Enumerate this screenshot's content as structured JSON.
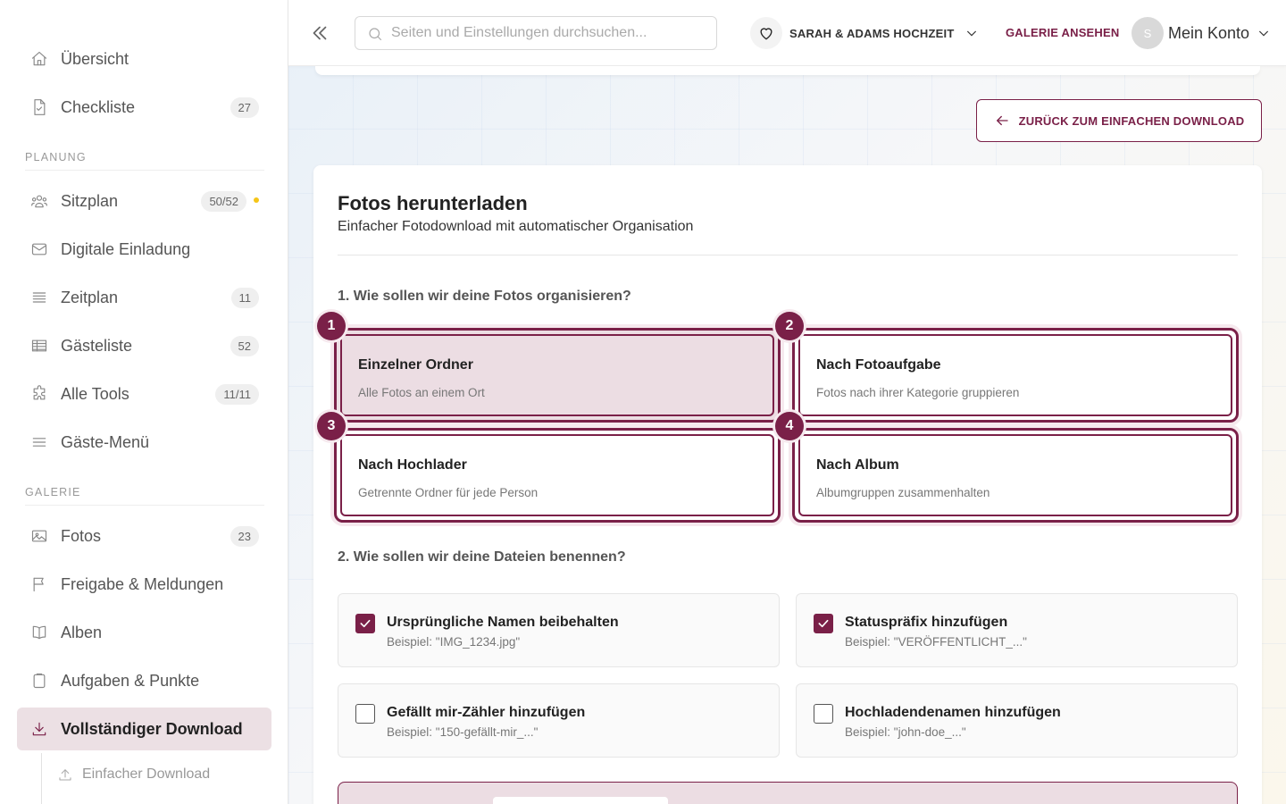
{
  "sidebar": {
    "items": [
      {
        "label": "Übersicht",
        "badge": null
      },
      {
        "label": "Checkliste",
        "badge": "27"
      },
      {
        "label": "Sitzplan",
        "badge": "50/52"
      },
      {
        "label": "Digitale Einladung",
        "badge": null
      },
      {
        "label": "Zeitplan",
        "badge": "11"
      },
      {
        "label": "Gästeliste",
        "badge": "52"
      },
      {
        "label": "Alle Tools",
        "badge": "11/11"
      },
      {
        "label": "Gäste-Menü",
        "badge": null
      },
      {
        "label": "Fotos",
        "badge": "23"
      },
      {
        "label": "Freigabe & Meldungen",
        "badge": null
      },
      {
        "label": "Alben",
        "badge": null
      },
      {
        "label": "Aufgaben & Punkte",
        "badge": null
      },
      {
        "label": "Vollständiger Download",
        "badge": null
      }
    ],
    "sections": {
      "planung": "PLANUNG",
      "galerie": "GALERIE"
    },
    "sub_item": "Einfacher Download",
    "status_dot_color": "#f5c518"
  },
  "topbar": {
    "search_placeholder": "Seiten und Einstellungen durchsuchen...",
    "event_name": "SARAH & ADAMS HOCHZEIT",
    "gallery_link": "GALERIE ANSEHEN",
    "avatar_initial": "S",
    "account_label": "Mein Konto"
  },
  "back_button": "ZURÜCK ZUM EINFACHEN DOWNLOAD",
  "card": {
    "title": "Fotos herunterladen",
    "subtitle": "Einfacher Fotodownload mit automatischer Organisation",
    "q1": "1. Wie sollen wir deine Fotos organisieren?",
    "options": [
      {
        "num": "1",
        "title": "Einzelner Ordner",
        "desc": "Alle Fotos an einem Ort",
        "selected": true
      },
      {
        "num": "2",
        "title": "Nach Fotoaufgabe",
        "desc": "Fotos nach ihrer Kategorie gruppieren",
        "selected": false
      },
      {
        "num": "3",
        "title": "Nach Hochlader",
        "desc": "Getrennte Ordner für jede Person",
        "selected": false
      },
      {
        "num": "4",
        "title": "Nach Album",
        "desc": "Albumgruppen zusammenhalten",
        "selected": false
      }
    ],
    "q2": "2. Wie sollen wir deine Dateien benennen?",
    "checkboxes": [
      {
        "title": "Ursprüngliche Namen beibehalten",
        "example": "Beispiel: \"IMG_1234.jpg\"",
        "checked": true
      },
      {
        "title": "Statuspräfix hinzufügen",
        "example": "Beispiel: \"VERÖFFENTLICHT_...\"",
        "checked": true
      },
      {
        "title": "Gefällt mir-Zähler hinzufügen",
        "example": "Beispiel: \"150-gefällt-mir_...\"",
        "checked": false
      },
      {
        "title": "Hochladendenamen hinzufügen",
        "example": "Beispiel: \"john-doe_...\"",
        "checked": false
      }
    ]
  },
  "colors": {
    "accent": "#7a2048",
    "selected_bg": "#ecdde3"
  }
}
